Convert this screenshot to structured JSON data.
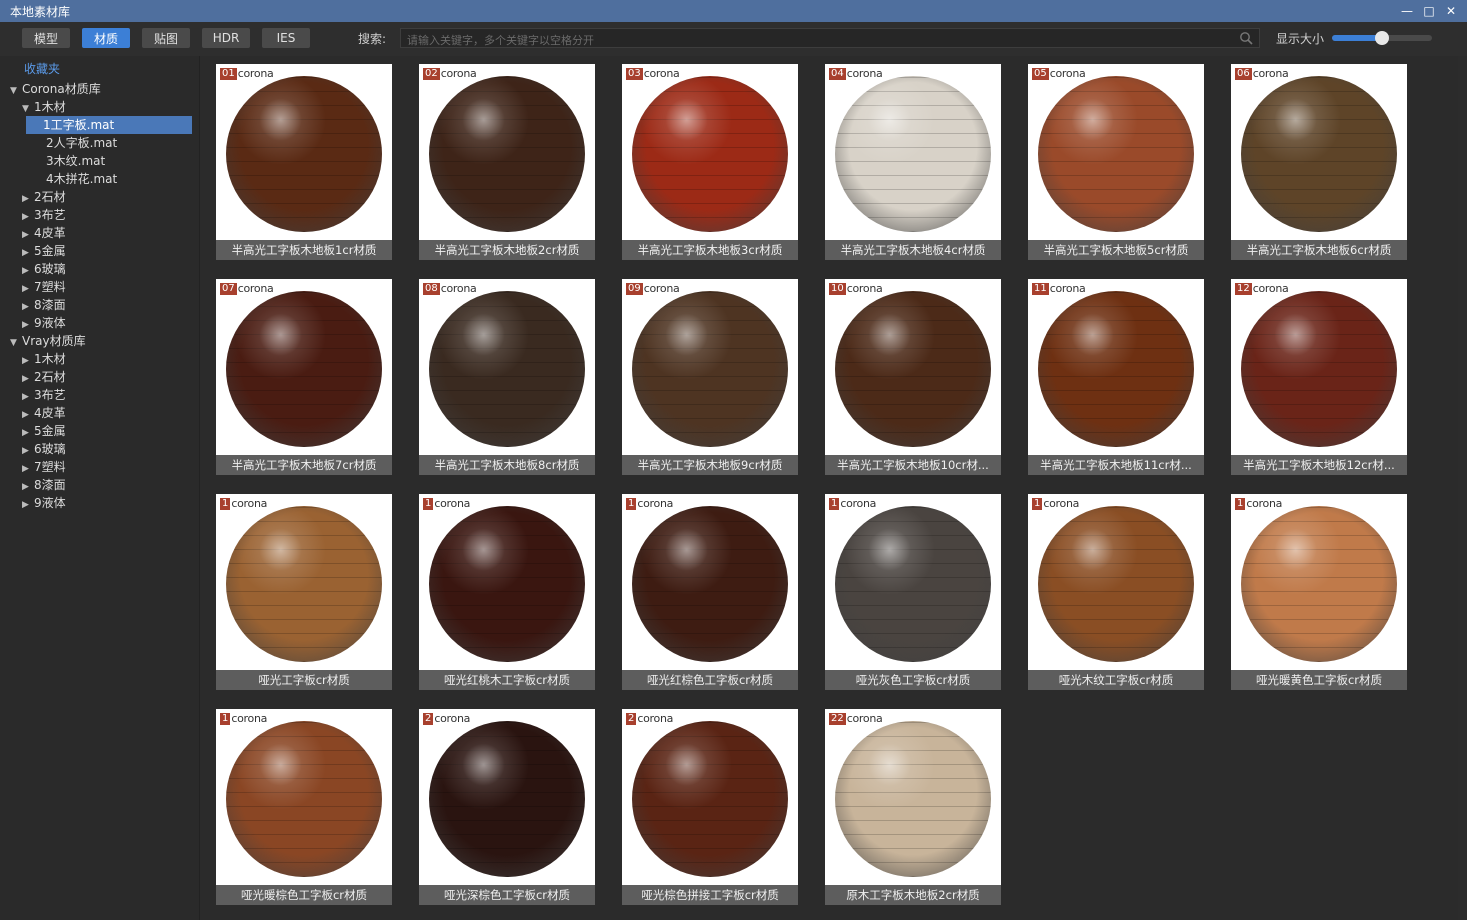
{
  "window": {
    "title": "本地素材库"
  },
  "toolbar": {
    "tabs": [
      {
        "label": "模型",
        "active": false
      },
      {
        "label": "材质",
        "active": true
      },
      {
        "label": "贴图",
        "active": false
      },
      {
        "label": "HDR",
        "active": false
      },
      {
        "label": "IES",
        "active": false
      }
    ],
    "search_label": "搜索:",
    "search_placeholder": "请输入关键字，多个关键字以空格分开",
    "size_label": "显示大小",
    "size_value": 0.5
  },
  "sidebar": {
    "favorites": "收藏夹",
    "tree": [
      {
        "label": "Corona材质库",
        "arrow": "▼",
        "depth": 0
      },
      {
        "label": "1木材",
        "arrow": "▼",
        "depth": 1
      },
      {
        "label": "1工字板.mat",
        "arrow": "",
        "depth": 2,
        "selected": true
      },
      {
        "label": "2人字板.mat",
        "arrow": "",
        "depth": 2
      },
      {
        "label": "3木纹.mat",
        "arrow": "",
        "depth": 2
      },
      {
        "label": "4木拼花.mat",
        "arrow": "",
        "depth": 2
      },
      {
        "label": "2石材",
        "arrow": "▶",
        "depth": 1
      },
      {
        "label": "3布艺",
        "arrow": "▶",
        "depth": 1
      },
      {
        "label": "4皮革",
        "arrow": "▶",
        "depth": 1
      },
      {
        "label": "5金属",
        "arrow": "▶",
        "depth": 1
      },
      {
        "label": "6玻璃",
        "arrow": "▶",
        "depth": 1
      },
      {
        "label": "7塑料",
        "arrow": "▶",
        "depth": 1
      },
      {
        "label": "8漆面",
        "arrow": "▶",
        "depth": 1
      },
      {
        "label": "9液体",
        "arrow": "▶",
        "depth": 1
      },
      {
        "label": "Vray材质库",
        "arrow": "▼",
        "depth": 0
      },
      {
        "label": "1木材",
        "arrow": "▶",
        "depth": 1
      },
      {
        "label": "2石材",
        "arrow": "▶",
        "depth": 1
      },
      {
        "label": "3布艺",
        "arrow": "▶",
        "depth": 1
      },
      {
        "label": "4皮革",
        "arrow": "▶",
        "depth": 1
      },
      {
        "label": "5金属",
        "arrow": "▶",
        "depth": 1
      },
      {
        "label": "6玻璃",
        "arrow": "▶",
        "depth": 1
      },
      {
        "label": "7塑料",
        "arrow": "▶",
        "depth": 1
      },
      {
        "label": "8漆面",
        "arrow": "▶",
        "depth": 1
      },
      {
        "label": "9液体",
        "arrow": "▶",
        "depth": 1
      }
    ]
  },
  "materials": [
    {
      "badge": "01",
      "brand": "corona",
      "caption": "半高光工字板木地板1cr材质",
      "color": "#5a2a14"
    },
    {
      "badge": "02",
      "brand": "corona",
      "caption": "半高光工字板木地板2cr材质",
      "color": "#3e2418"
    },
    {
      "badge": "03",
      "brand": "corona",
      "caption": "半高光工字板木地板3cr材质",
      "color": "#9c2a16"
    },
    {
      "badge": "04",
      "brand": "corona",
      "caption": "半高光工字板木地板4cr材质",
      "color": "#d8d2c8"
    },
    {
      "badge": "05",
      "brand": "corona",
      "caption": "半高光工字板木地板5cr材质",
      "color": "#9a4a2a"
    },
    {
      "badge": "06",
      "brand": "corona",
      "caption": "半高光工字板木地板6cr材质",
      "color": "#5e4428"
    },
    {
      "badge": "07",
      "brand": "corona",
      "caption": "半高光工字板木地板7cr材质",
      "color": "#4a1c12"
    },
    {
      "badge": "08",
      "brand": "corona",
      "caption": "半高光工字板木地板8cr材质",
      "color": "#3a2a20"
    },
    {
      "badge": "09",
      "brand": "corona",
      "caption": "半高光工字板木地板9cr材质",
      "color": "#4e3422"
    },
    {
      "badge": "10",
      "brand": "corona",
      "caption": "半高光工字板木地板10cr材...",
      "color": "#4c2a18"
    },
    {
      "badge": "11",
      "brand": "corona",
      "caption": "半高光工字板木地板11cr材...",
      "color": "#6e3012"
    },
    {
      "badge": "12",
      "brand": "corona",
      "caption": "半高光工字板木地板12cr材...",
      "color": "#6a2418"
    },
    {
      "badge": "1",
      "brand": "corona",
      "caption": "哑光工字板cr材质",
      "color": "#9a6232"
    },
    {
      "badge": "1",
      "brand": "corona",
      "caption": "哑光红桃木工字板cr材质",
      "color": "#3a1610"
    },
    {
      "badge": "1",
      "brand": "corona",
      "caption": "哑光红棕色工字板cr材质",
      "color": "#3e1c12"
    },
    {
      "badge": "1",
      "brand": "corona",
      "caption": "哑光灰色工字板cr材质",
      "color": "#4a4440"
    },
    {
      "badge": "1",
      "brand": "corona",
      "caption": "哑光木纹工字板cr材质",
      "color": "#8a4e24"
    },
    {
      "badge": "1",
      "brand": "corona",
      "caption": "哑光暖黄色工字板cr材质",
      "color": "#c07a4a"
    },
    {
      "badge": "1",
      "brand": "corona",
      "caption": "哑光暖棕色工字板cr材质",
      "color": "#8a4624"
    },
    {
      "badge": "2",
      "brand": "corona",
      "caption": "哑光深棕色工字板cr材质",
      "color": "#2a1410"
    },
    {
      "badge": "2",
      "brand": "corona",
      "caption": "哑光棕色拼接工字板cr材质",
      "color": "#5a2414"
    },
    {
      "badge": "22",
      "brand": "corona",
      "caption": "原木工字板木地板2cr材质",
      "color": "#c8b49a"
    }
  ]
}
